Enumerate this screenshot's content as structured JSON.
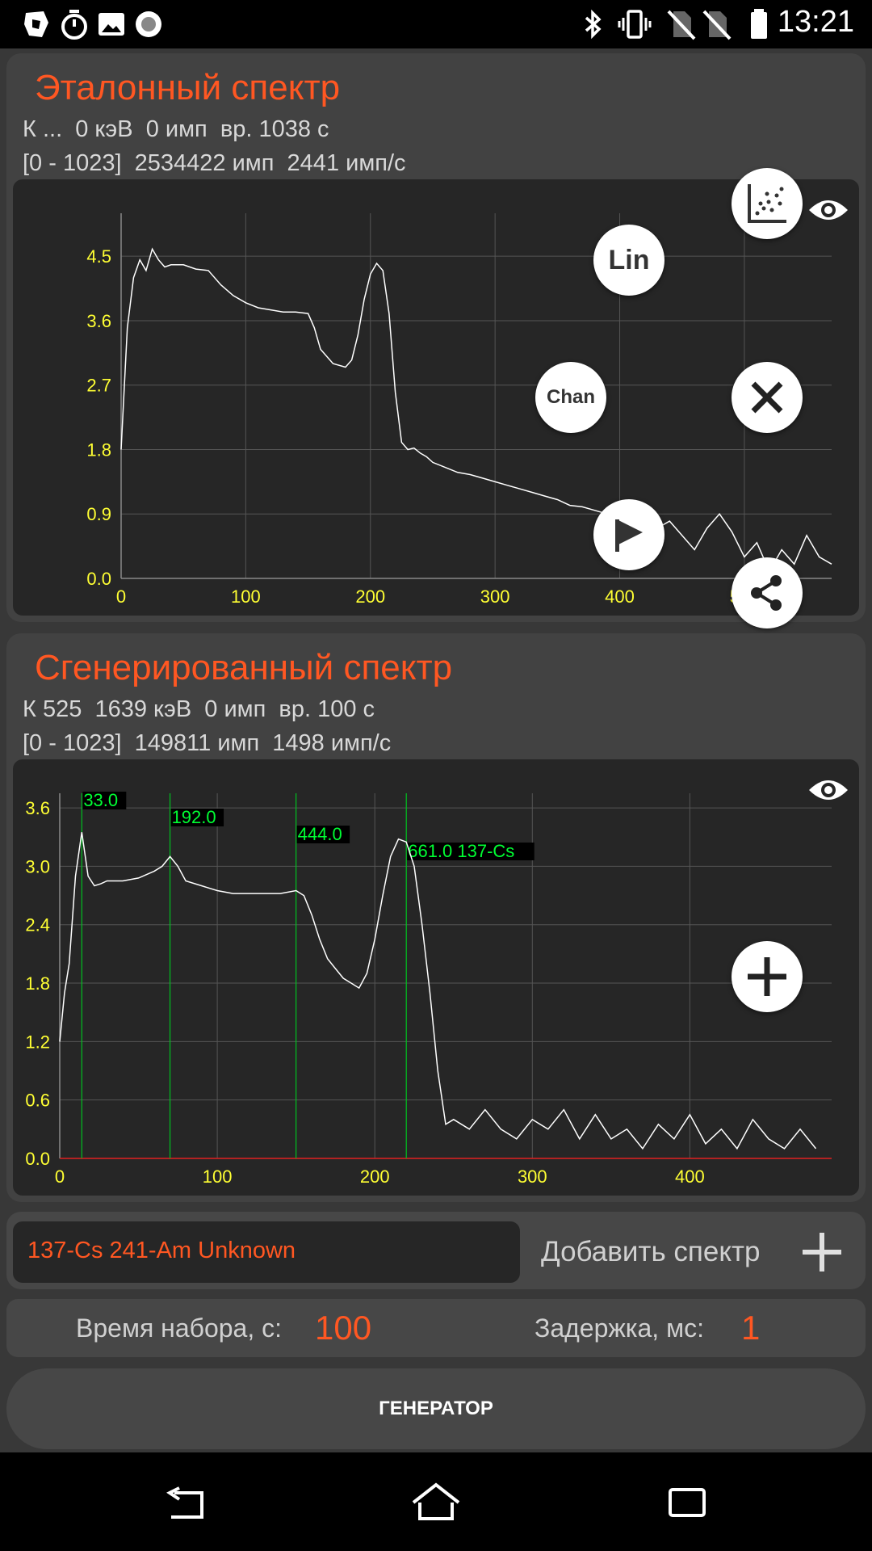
{
  "status_bar": {
    "time": "13:21"
  },
  "reference": {
    "title": "Эталонный спектр",
    "info1": "К ...  0 кэВ  0 имп  вр. 1038 с",
    "info2": "[0 - 1023]  2534422 имп  2441 имп/с",
    "buttons": {
      "lin": "Lin",
      "chan": "Chan"
    }
  },
  "generated": {
    "title": "Сгенерированный спектр",
    "info1": "К 525  1639 кэВ  0 имп  вр. 100 с",
    "info2": "[0 - 1023]  149811 имп  1498 имп/с"
  },
  "chart_data": [
    {
      "type": "line",
      "x_ticks": [
        "0",
        "100",
        "200",
        "300",
        "400",
        "500"
      ],
      "y_ticks": [
        "0.0",
        "0.9",
        "1.8",
        "2.7",
        "3.6",
        "4.5"
      ],
      "xlim": [
        0,
        570
      ],
      "ylim": [
        0,
        5.1
      ],
      "grid": true,
      "series": [
        {
          "x": [
            0,
            5,
            10,
            15,
            20,
            25,
            30,
            35,
            40,
            50,
            60,
            70,
            80,
            90,
            100,
            110,
            120,
            130,
            140,
            150,
            155,
            160,
            170,
            180,
            185,
            190,
            195,
            200,
            205,
            210,
            215,
            220,
            225,
            230,
            235,
            240,
            245,
            250,
            260,
            270,
            280,
            290,
            300,
            310,
            320,
            330,
            340,
            350,
            360,
            370,
            380,
            390,
            400,
            410,
            420,
            430,
            440,
            450,
            460,
            470,
            480,
            490,
            500,
            510,
            520,
            530,
            540,
            550,
            560,
            570
          ],
          "y": [
            1.8,
            3.5,
            4.2,
            4.45,
            4.3,
            4.6,
            4.45,
            4.35,
            4.38,
            4.38,
            4.32,
            4.3,
            4.1,
            3.95,
            3.85,
            3.78,
            3.75,
            3.72,
            3.72,
            3.7,
            3.5,
            3.2,
            3.0,
            2.95,
            3.05,
            3.4,
            3.9,
            4.25,
            4.4,
            4.3,
            3.7,
            2.6,
            1.9,
            1.8,
            1.82,
            1.75,
            1.7,
            1.62,
            1.55,
            1.48,
            1.45,
            1.4,
            1.35,
            1.3,
            1.25,
            1.2,
            1.15,
            1.1,
            1.02,
            1.0,
            0.95,
            0.9,
            0.8,
            0.9,
            0.75,
            0.7,
            0.8,
            0.6,
            0.4,
            0.7,
            0.9,
            0.65,
            0.3,
            0.5,
            0.1,
            0.4,
            0.2,
            0.6,
            0.3,
            0.2
          ]
        }
      ]
    },
    {
      "type": "line",
      "x_ticks": [
        "0",
        "100",
        "200",
        "300",
        "400"
      ],
      "y_ticks": [
        "0.0",
        "0.6",
        "1.2",
        "1.8",
        "2.4",
        "3.0",
        "3.6"
      ],
      "xlim": [
        0,
        490
      ],
      "ylim": [
        0,
        3.75
      ],
      "grid": true,
      "series": [
        {
          "x": [
            0,
            3,
            6,
            10,
            14,
            18,
            22,
            26,
            30,
            40,
            50,
            60,
            65,
            70,
            75,
            80,
            90,
            100,
            110,
            120,
            130,
            140,
            150,
            155,
            160,
            165,
            170,
            175,
            180,
            185,
            190,
            195,
            200,
            205,
            210,
            215,
            220,
            225,
            230,
            235,
            240,
            245,
            250,
            260,
            270,
            280,
            290,
            300,
            310,
            320,
            330,
            340,
            350,
            360,
            370,
            380,
            390,
            400,
            410,
            420,
            430,
            440,
            450,
            460,
            470,
            480
          ],
          "y": [
            1.2,
            1.7,
            2.0,
            2.9,
            3.35,
            2.9,
            2.8,
            2.82,
            2.85,
            2.85,
            2.88,
            2.95,
            3.0,
            3.1,
            3.0,
            2.85,
            2.8,
            2.75,
            2.72,
            2.72,
            2.72,
            2.72,
            2.75,
            2.7,
            2.5,
            2.25,
            2.05,
            1.95,
            1.85,
            1.8,
            1.75,
            1.9,
            2.25,
            2.7,
            3.1,
            3.28,
            3.25,
            3.0,
            2.4,
            1.7,
            0.9,
            0.35,
            0.4,
            0.3,
            0.5,
            0.3,
            0.2,
            0.4,
            0.3,
            0.5,
            0.2,
            0.45,
            0.2,
            0.3,
            0.1,
            0.35,
            0.2,
            0.45,
            0.15,
            0.3,
            0.1,
            0.4,
            0.2,
            0.1,
            0.3,
            0.1
          ]
        }
      ],
      "markers": [
        {
          "x": 14,
          "label": "33.0"
        },
        {
          "x": 70,
          "label": "192.0"
        },
        {
          "x": 150,
          "label": "444.0"
        },
        {
          "x": 220,
          "label": "661.0  137-Cs"
        }
      ]
    }
  ],
  "isotopes_field": {
    "value": "137-Cs 241-Am Unknown"
  },
  "add_spectrum_label": "Добавить спектр",
  "time_row": {
    "label": "Время набора, с:",
    "value": "100",
    "delay_label": "Задержка, мс:",
    "delay_value": "1"
  },
  "generator_button": "ГЕНЕРАТОР",
  "colors": {
    "accent": "#ff5722",
    "plot_line": "#ffffff",
    "tick_labels": "#ffff33",
    "marker": "#00ff33"
  },
  "icons": [
    "photo-icon",
    "timer-icon",
    "image-icon",
    "record-icon",
    "bluetooth-icon",
    "vibrate-icon",
    "no-sim-icon",
    "battery-icon",
    "scatter-plot-icon",
    "eye-icon",
    "close-icon",
    "flag-icon",
    "share-icon",
    "plus-icon",
    "back-icon",
    "home-icon",
    "recents-icon"
  ]
}
